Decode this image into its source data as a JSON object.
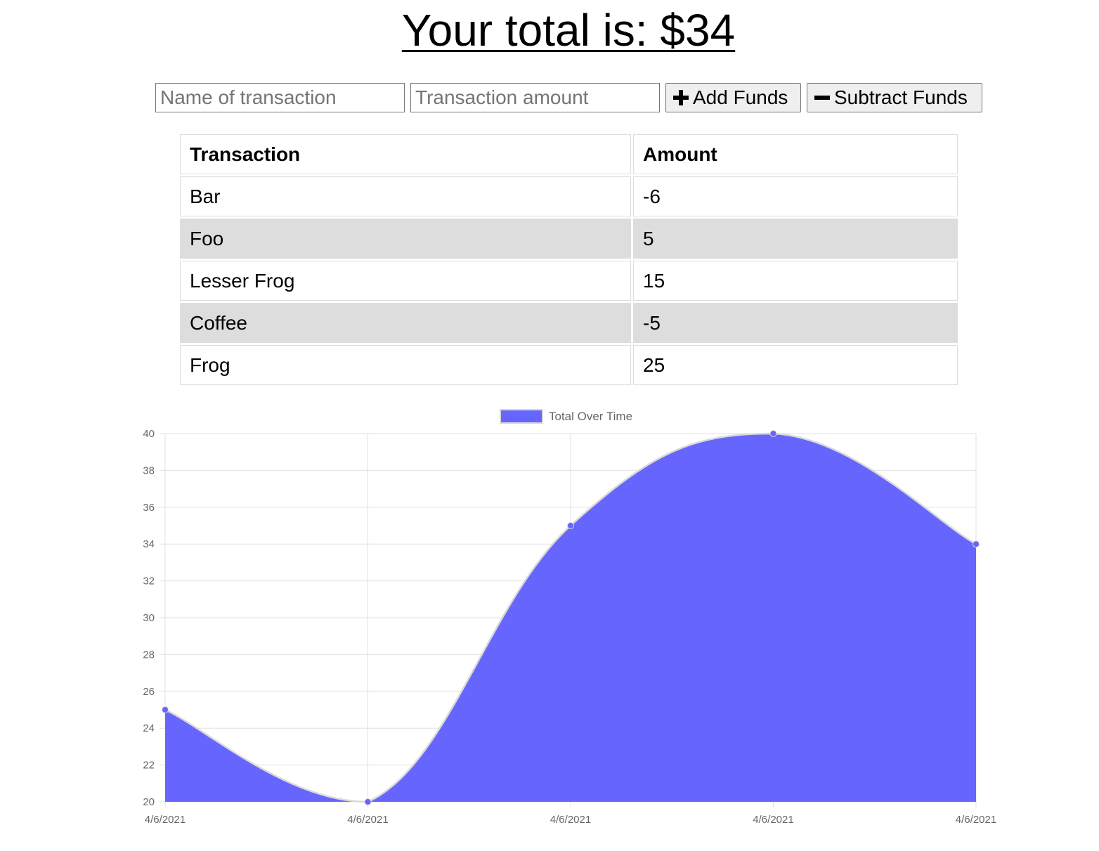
{
  "header": {
    "total_text": "Your total is: $34"
  },
  "form": {
    "name_placeholder": "Name of transaction",
    "amount_placeholder": "Transaction amount",
    "add_label": "Add Funds",
    "subtract_label": "Subtract Funds"
  },
  "table": {
    "headers": [
      "Transaction",
      "Amount"
    ],
    "rows": [
      {
        "name": "Bar",
        "amount": "-6"
      },
      {
        "name": "Foo",
        "amount": "5"
      },
      {
        "name": "Lesser Frog",
        "amount": "15"
      },
      {
        "name": "Coffee",
        "amount": "-5"
      },
      {
        "name": "Frog",
        "amount": "25"
      }
    ]
  },
  "colors": {
    "series_fill": "#6666ff",
    "series_point": "#6666ff",
    "row_alt_bg": "#dddddd"
  },
  "chart_data": {
    "type": "area",
    "title": "",
    "xlabel": "",
    "ylabel": "",
    "categories": [
      "4/6/2021",
      "4/6/2021",
      "4/6/2021",
      "4/6/2021",
      "4/6/2021"
    ],
    "series": [
      {
        "name": "Total Over Time",
        "values": [
          25,
          20,
          35,
          40,
          34
        ]
      }
    ],
    "ylim": [
      20,
      40
    ],
    "y_ticks": [
      20,
      22,
      24,
      26,
      28,
      30,
      32,
      34,
      36,
      38,
      40
    ],
    "grid": true,
    "legend_position": "top"
  }
}
